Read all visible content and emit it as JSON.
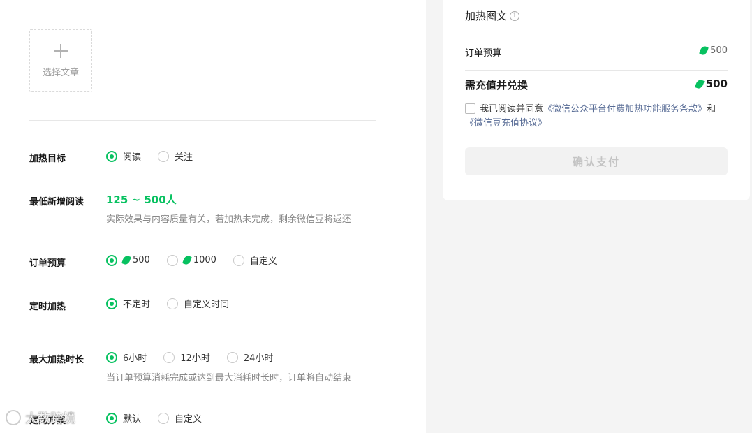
{
  "select_article": {
    "label": "选择文章"
  },
  "heat_target": {
    "label": "加热目标",
    "options": [
      "阅读",
      "关注"
    ],
    "selected": 0
  },
  "min_reads": {
    "label": "最低新增阅读",
    "value": "125 ~ 500人",
    "hint": "实际效果与内容质量有关，若加热未完成，剩余微信豆将返还"
  },
  "budget": {
    "label": "订单预算",
    "options": [
      "500",
      "1000",
      "自定义"
    ],
    "selected": 0
  },
  "schedule": {
    "label": "定时加热",
    "options": [
      "不定时",
      "自定义时间"
    ],
    "selected": 0
  },
  "max_duration": {
    "label": "最大加热时长",
    "options": [
      "6小时",
      "12小时",
      "24小时"
    ],
    "selected": 0,
    "hint": "当订单预算消耗完成或达到最大消耗时长时，订单将自动结束"
  },
  "targeting": {
    "label": "定向方案",
    "options": [
      "默认",
      "自定义"
    ],
    "selected": 0
  },
  "summary": {
    "title": "加热图文",
    "info_icon": "i",
    "budget_label": "订单预算",
    "budget_value": "500",
    "recharge_label": "需充值并兑换",
    "recharge_value": "500",
    "agree_prefix": "我已阅读并同意",
    "agree_link1": "《微信公众平台付费加热功能服务条款》",
    "agree_and": "和",
    "agree_link2": "《微信豆充值协议》",
    "pay_button": "确认支付"
  },
  "watermark": "大数跨境",
  "colors": {
    "accent": "#07c160",
    "link": "#576b95"
  }
}
